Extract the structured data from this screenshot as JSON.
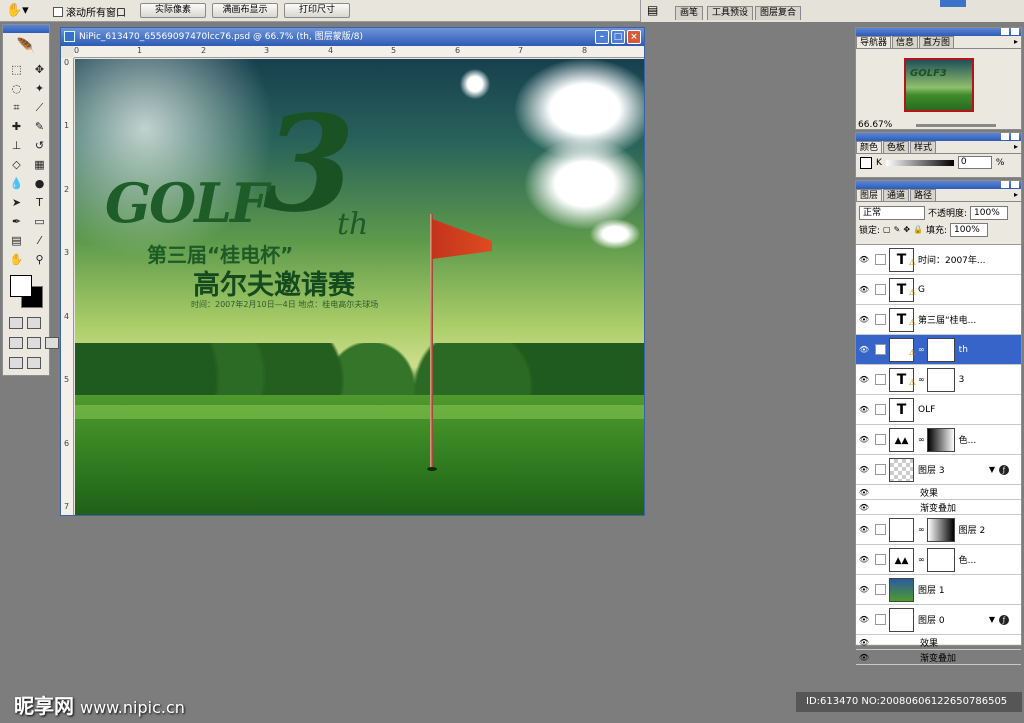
{
  "options_bar": {
    "checkbox_label": "滚动所有窗口",
    "buttons": [
      "实际像素",
      "满画布显示",
      "打印尺寸"
    ]
  },
  "palette_well": {
    "tabs": [
      "画笔",
      "工具预设",
      "图层复合"
    ]
  },
  "document": {
    "title": "NiPic_613470_65569097470lcc76.psd @ 66.7% (th, 图层蒙版/8)",
    "ruler_h": [
      "0",
      "1",
      "2",
      "3",
      "4",
      "5",
      "6",
      "7",
      "8"
    ],
    "ruler_v": [
      "0",
      "1",
      "2",
      "3",
      "4",
      "5",
      "6",
      "7"
    ],
    "artwork": {
      "golf": "GOLF",
      "three": "3",
      "th": "th",
      "line1": "第三届“桂电杯”",
      "line2": "高尔夫邀请赛",
      "small": "时间：2007年2月10日—4日  地点：桂电高尔夫球场"
    }
  },
  "navigator_panel": {
    "tabs": [
      "导航器",
      "信息",
      "直方图"
    ],
    "zoom": "66.67%",
    "thumb_text": "GOLF3"
  },
  "color_panel": {
    "tabs": [
      "颜色",
      "色板",
      "样式"
    ],
    "channel": "K",
    "value": "0",
    "unit": "%"
  },
  "layers_panel": {
    "tabs": [
      "图层",
      "通道",
      "路径"
    ],
    "blend_mode": "正常",
    "opacity_label": "不透明度:",
    "opacity": "100%",
    "lock_label": "锁定:",
    "fill_label": "填充:",
    "fill": "100%",
    "layers": [
      {
        "name": "时间：2007年...",
        "thumb": "T"
      },
      {
        "name": "G",
        "thumb": "T"
      },
      {
        "name": "第三届“桂电...",
        "thumb": "T"
      },
      {
        "name": "th",
        "thumb": "T",
        "selected": true
      },
      {
        "name": "3",
        "thumb": "T"
      },
      {
        "name": "OLF",
        "thumb": "T"
      },
      {
        "name": "色...",
        "thumb": "adj"
      },
      {
        "name": "图层 3",
        "thumb": "checker"
      },
      {
        "name": "效果",
        "thumb": "sub"
      },
      {
        "name": "渐变叠加",
        "thumb": "sub"
      },
      {
        "name": "图层 2",
        "thumb": "white"
      },
      {
        "name": "色...",
        "thumb": "adj"
      },
      {
        "name": "图层 1",
        "thumb": "img"
      },
      {
        "name": "图层 0",
        "thumb": "white"
      },
      {
        "name": "效果",
        "thumb": "sub"
      },
      {
        "name": "渐变叠加",
        "thumb": "sub"
      }
    ]
  },
  "watermark": {
    "site_name": "昵享网",
    "site_url": "www.nipic.cn",
    "id_text": "ID:613470 NO:20080606122650786505"
  },
  "colors": {
    "selection": "#3764c8",
    "flag": "#d43a1c",
    "title_text": "#1e5c2a"
  }
}
